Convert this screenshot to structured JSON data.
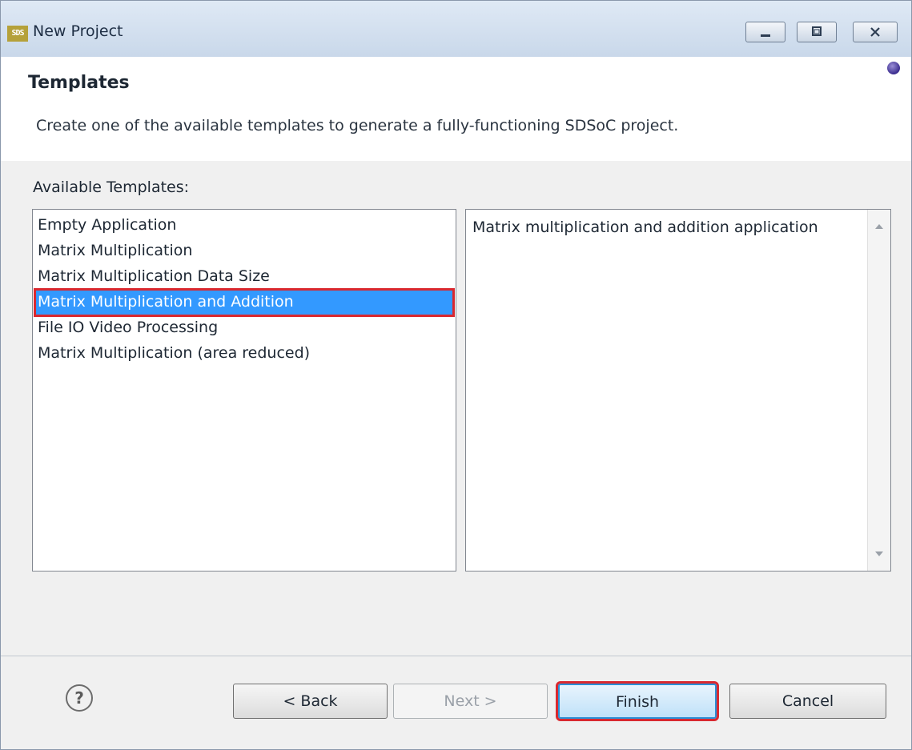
{
  "window": {
    "app_icon_text": "SDS",
    "title": "New Project",
    "controls": {
      "minimize_icon": "minimize-icon",
      "maximize_icon": "maximize-icon",
      "close_icon": "close-icon"
    }
  },
  "header": {
    "title": "Templates",
    "description": "Create one of the available templates to generate a fully-functioning SDSoC project."
  },
  "templates": {
    "label": "Available Templates:",
    "items": [
      "Empty Application",
      "Matrix Multiplication",
      "Matrix Multiplication Data Size",
      "Matrix Multiplication and Addition",
      "File IO Video Processing",
      "Matrix Multiplication (area reduced)"
    ],
    "selected_index": 3,
    "selected_description": "Matrix multiplication and addition application"
  },
  "footer": {
    "help_symbol": "?",
    "back_label": "< Back",
    "next_label": "Next >",
    "finish_label": "Finish",
    "cancel_label": "Cancel"
  },
  "colors": {
    "selection": "#3399ff",
    "highlight_outline": "#d9282f",
    "finish_border": "#2a8fd6"
  }
}
